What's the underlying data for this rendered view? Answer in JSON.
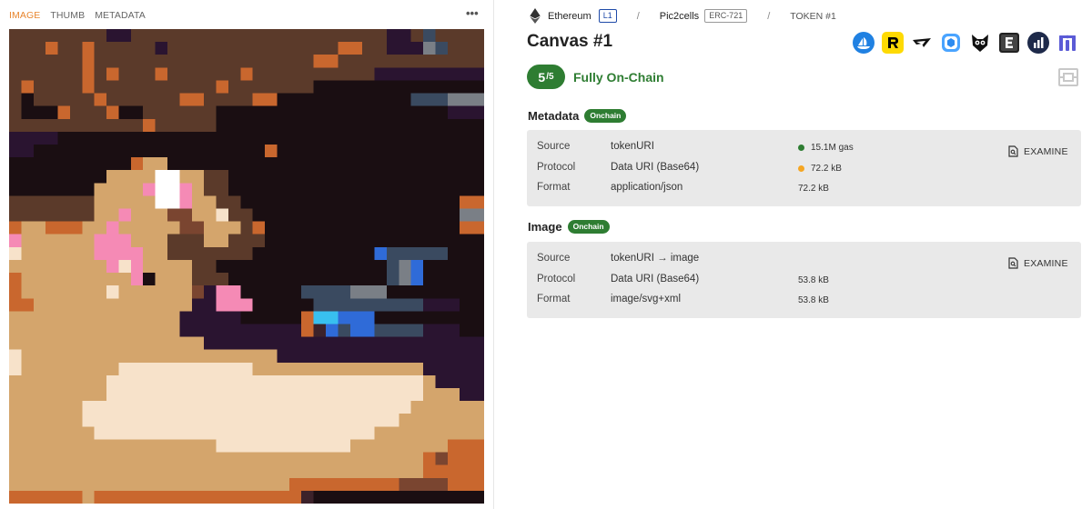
{
  "view_tabs": [
    {
      "label": "IMAGE",
      "active": true
    },
    {
      "label": "THUMB",
      "active": false
    },
    {
      "label": "METADATA",
      "active": false
    }
  ],
  "more_label": "•••",
  "pixel_art": {
    "palette": {
      "a": "#5b3a2a",
      "b": "#1a0e12",
      "c": "#2a1430",
      "d": "#c9672e",
      "e": "#d4a56c",
      "f": "#f7e2ca",
      "g": "#f58ab5",
      "h": "#ffffff",
      "i": "#3a4a60",
      "j": "#7a7f86",
      "k": "#2f6bd8",
      "l": "#38c0ef",
      "m": "#7a4530",
      "n": "#3c222a"
    },
    "rows": [
      "aaaaaaaaccaaaaaaaaaaaaaaaaaaaaaccaiaa",
      "aaadaadaaaaacaaaaaaaaaaaaaaddaacccjia",
      "aaaaaadaaaaaaaaaaaaaaaaaaddaaaaaaaaaa",
      "aaaaaadadaaadaaaaaadaaaaaaaaaacccccccc",
      "adaaaadaaaaaaaaaadaaaaaaabbbbbbbbbbbb",
      "abaaaaadaaaaaaddaaaaddbbbbbbbbbbbiiij",
      "abbbdaaadbbaaaaaabbbbbbbbbbbbbbbbbbbcc",
      "aaaaaaaaaaadaaaaabbbbbbbbbbbbbbbbbbbbb",
      "ccccbbbbbbbbbbbbbbbbbbbbbbbbbbbbbbbbbb",
      "ccbbbbbbbbbbbbbbbbbbbdbbbbbbbbbbbbbbbb",
      "bbbbbbbbbbdeebbbbbbbbbbbbbbbbbbbbbbbbb",
      "bbbbbbbbeeeehheeaabbbbbbbbbbbbbbbbbbbb",
      "bbbbbbbeeeeghhgeaabbbbbbbbbbbbbbbbbbbb",
      "aaaaaaaeeeeehhgeeaabbbbbbbbbbbbbbbbbbd",
      "aaaaaaaeegeeemmeefaabbbbbbbbbbbbbbbbbj",
      "deedddeegeeeeemmeeeadbbbbbbbbbbbbbbbbd",
      "geeeeeegggeeeaaaeeaaabbbbbbbbbbbbbbbbb",
      "feeeeeeggggeeaaaaaaabbbbbbbbbbkiiiiibb",
      "eeeeeeeegfgeeeeaabbbbbbbbbbbbbbijkbbbb",
      "deeeeeeeeegbeeeaaabbbbbbbbbbbbbijkbbbb",
      "deeeeeeefeeeeeemcggbbbbbiiiijjjbbbbbbb",
      "ddeeeeeeeeeeeeeccgggbbbbbiiiiiiiiicccb",
      "eeeeeeeeeeeeeecccccbbbbbdllkkkbbbbbbbb",
      "eeeeeeeeeeeeeeccccccccccdnkikkiiiicccb",
      "eeeeeeeeeeeeeeeeccccccccccccccccccccc",
      "feeeeeeeeeeeeeeeeeeeeeccccccccccccccc",
      "feeeeeeeefffffffffffeeeeeeeeeeeeeecccc",
      "eeeeeeeeffffffffffffffffffffffffffeccc",
      "eeeeeeeeffffffffffffffffffffffffffeeec",
      "eeeeeefffffffffffffffffffffffffffeeeee",
      "eeeeeeffffffffffffffffffffffffffeeeeeee",
      "eeeeeeefffffffffffffffffffffffeeeeeeee",
      "eeeeeeeeeeeeeeeeefffffffffffeeeeeeeedd",
      "eeeeeeeeeeeeeeeeeeeeeeeeeeeeeeeeeedmd",
      "eeeeeeeeeeeeeeeeeeeeeeeeeeeeeeeeeedddd",
      "eeeeeeeeeeeeeeeeeeeeeeedddddddddmmmmdd",
      "ddddddedddddddddddddddddnbbbbbbbbbbbbbb"
    ]
  },
  "breadcrumb": {
    "chain": "Ethereum",
    "layer": "L1",
    "separator": "/",
    "collection": "Pic2cells",
    "standard": "ERC-721",
    "token": "TOKEN #1"
  },
  "title": "Canvas #1",
  "marketplaces": [
    {
      "icon": "opensea-icon"
    },
    {
      "icon": "rarible-icon"
    },
    {
      "icon": "reservoir-icon"
    },
    {
      "icon": "magic-eden-icon"
    },
    {
      "icon": "blur-icon"
    },
    {
      "icon": "etherscan-icon"
    },
    {
      "icon": "nftgo-icon"
    },
    {
      "icon": "element-icon"
    }
  ],
  "score": {
    "value": "5",
    "denominator": "/5",
    "label": "Fully On-Chain"
  },
  "metadata_section": {
    "title": "Metadata",
    "chip": "Onchain",
    "rows": [
      {
        "key": "Source",
        "value": "tokenURI",
        "meta": "15.1M gas",
        "dot": "#2e7d32"
      },
      {
        "key": "Protocol",
        "value": "Data URI (Base64)",
        "meta": "72.2 kB",
        "dot": "#f5a623"
      },
      {
        "key": "Format",
        "value": "application/json",
        "meta": "72.2 kB",
        "dot": ""
      }
    ],
    "examine": "EXAMINE"
  },
  "image_section": {
    "title": "Image",
    "chip": "Onchain",
    "rows": [
      {
        "key": "Source",
        "value": "tokenURI → image",
        "meta": ""
      },
      {
        "key": "Protocol",
        "value": "Data URI (Base64)",
        "meta": "53.8 kB"
      },
      {
        "key": "Format",
        "value": "image/svg+xml",
        "meta": "53.8 kB"
      }
    ],
    "examine": "EXAMINE"
  }
}
